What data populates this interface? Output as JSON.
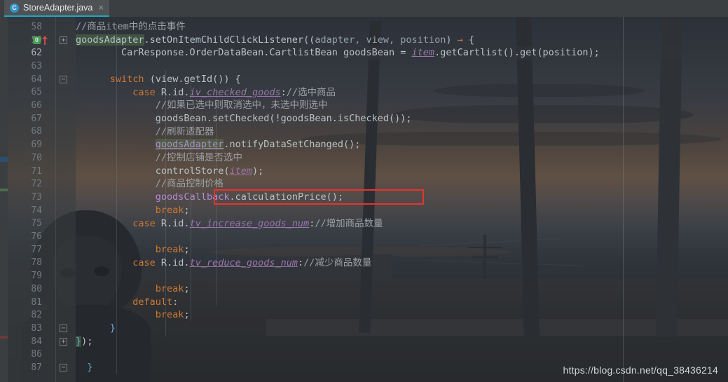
{
  "window": {
    "app": "IntelliJ IDEA code editor",
    "watermark": "https://blog.csdn.net/qq_38436214"
  },
  "tab": {
    "icon": "java-class-icon",
    "icon_letter": "C",
    "title": "StoreAdapter.java",
    "close_label": "×"
  },
  "gutter": {
    "line_numbers": [
      "58",
      "59",
      "62",
      "63",
      "64",
      "65",
      "66",
      "67",
      "68",
      "69",
      "70",
      "71",
      "72",
      "73",
      "74",
      "75",
      "76",
      "77",
      "78",
      "79",
      "80",
      "81",
      "82",
      "83",
      "84",
      "86",
      "87"
    ],
    "current_line": "62",
    "intention_bulb": "0",
    "fold_markers": [
      {
        "line": "59",
        "glyph": "+"
      },
      {
        "line": "64",
        "glyph": "−"
      },
      {
        "line": "83",
        "glyph": "−"
      },
      {
        "line": "84",
        "glyph": "+"
      },
      {
        "line": "87",
        "glyph": "−"
      }
    ]
  },
  "code": {
    "lines": [
      {
        "n": "58",
        "indent": 0,
        "tokens": [
          {
            "t": "//商品item中的点击事件",
            "c": "cmt"
          }
        ]
      },
      {
        "n": "59",
        "indent": 0,
        "tokens": [
          {
            "t": "goodsAdapter",
            "c": "plain hl"
          },
          {
            "t": ".setOnItemChildClickListener((",
            "c": "plain"
          },
          {
            "t": "adapter, view, position",
            "c": "param"
          },
          {
            "t": ") ",
            "c": "plain"
          },
          {
            "t": "→",
            "c": "arrow"
          },
          {
            "t": " {",
            "c": "plain"
          }
        ]
      },
      {
        "n": "62",
        "indent": 0,
        "tokens": [
          {
            "t": "        CarResponse.OrderDataBean.CartlistBean goodsBean = ",
            "c": "plain"
          },
          {
            "t": "item",
            "c": "fieldi"
          },
          {
            "t": ".getCartlist().get(position);",
            "c": "plain"
          }
        ]
      },
      {
        "n": "63",
        "indent": 0,
        "tokens": []
      },
      {
        "n": "64",
        "indent": 0,
        "tokens": [
          {
            "t": "      ",
            "c": "plain"
          },
          {
            "t": "switch",
            "c": "kw"
          },
          {
            "t": " (view.getId()) {",
            "c": "plain"
          }
        ]
      },
      {
        "n": "65",
        "indent": 0,
        "tokens": [
          {
            "t": "          ",
            "c": "plain"
          },
          {
            "t": "case",
            "c": "kw"
          },
          {
            "t": " R.id.",
            "c": "plain"
          },
          {
            "t": "iv_checked_goods",
            "c": "fieldi"
          },
          {
            "t": ":",
            "c": "plain"
          },
          {
            "t": "//选中商品",
            "c": "cmt"
          }
        ]
      },
      {
        "n": "66",
        "indent": 0,
        "tokens": [
          {
            "t": "              ",
            "c": "plain"
          },
          {
            "t": "//如果已选中则取消选中，未选中则选中",
            "c": "cmt"
          }
        ]
      },
      {
        "n": "67",
        "indent": 0,
        "tokens": [
          {
            "t": "              goodsBean.setChecked(!goodsBean.isChecked());",
            "c": "plain"
          }
        ]
      },
      {
        "n": "68",
        "indent": 0,
        "tokens": [
          {
            "t": "              ",
            "c": "plain"
          },
          {
            "t": "//刷新适配器",
            "c": "cmt"
          }
        ]
      },
      {
        "n": "69",
        "indent": 0,
        "tokens": [
          {
            "t": "              ",
            "c": "plain"
          },
          {
            "t": "goodsAdapter",
            "c": "field hl und"
          },
          {
            "t": ".notifyDataSetChanged();",
            "c": "plain"
          }
        ]
      },
      {
        "n": "70",
        "indent": 0,
        "tokens": [
          {
            "t": "              ",
            "c": "plain"
          },
          {
            "t": "//控制店铺是否选中",
            "c": "cmt"
          }
        ]
      },
      {
        "n": "71",
        "indent": 0,
        "tokens": [
          {
            "t": "              controlStore(",
            "c": "plain"
          },
          {
            "t": "item",
            "c": "fieldi"
          },
          {
            "t": ");",
            "c": "plain"
          }
        ]
      },
      {
        "n": "72",
        "indent": 0,
        "tokens": [
          {
            "t": "              ",
            "c": "plain"
          },
          {
            "t": "//商品控制价格",
            "c": "cmt"
          }
        ]
      },
      {
        "n": "73",
        "indent": 0,
        "tokens": [
          {
            "t": "              ",
            "c": "plain"
          },
          {
            "t": "goodsCallback",
            "c": "field"
          },
          {
            "t": ".calculationPrice();",
            "c": "plain"
          }
        ]
      },
      {
        "n": "74",
        "indent": 0,
        "tokens": [
          {
            "t": "              ",
            "c": "plain"
          },
          {
            "t": "break",
            "c": "kw"
          },
          {
            "t": ";",
            "c": "plain"
          }
        ]
      },
      {
        "n": "75",
        "indent": 0,
        "tokens": [
          {
            "t": "          ",
            "c": "plain"
          },
          {
            "t": "case",
            "c": "kw"
          },
          {
            "t": " R.id.",
            "c": "plain"
          },
          {
            "t": "tv_increase_goods_num",
            "c": "fieldi"
          },
          {
            "t": ":",
            "c": "plain"
          },
          {
            "t": "//增加商品数量",
            "c": "cmt"
          }
        ]
      },
      {
        "n": "76",
        "indent": 0,
        "tokens": []
      },
      {
        "n": "77",
        "indent": 0,
        "tokens": [
          {
            "t": "              ",
            "c": "plain"
          },
          {
            "t": "break",
            "c": "kw"
          },
          {
            "t": ";",
            "c": "plain"
          }
        ]
      },
      {
        "n": "78",
        "indent": 0,
        "tokens": [
          {
            "t": "          ",
            "c": "plain"
          },
          {
            "t": "case",
            "c": "kw"
          },
          {
            "t": " R.id.",
            "c": "plain"
          },
          {
            "t": "tv_reduce_goods_num",
            "c": "fieldi"
          },
          {
            "t": ":",
            "c": "plain"
          },
          {
            "t": "//减少商品数量",
            "c": "cmt"
          }
        ]
      },
      {
        "n": "79",
        "indent": 0,
        "tokens": []
      },
      {
        "n": "80",
        "indent": 0,
        "tokens": [
          {
            "t": "              ",
            "c": "plain"
          },
          {
            "t": "break",
            "c": "kw"
          },
          {
            "t": ";",
            "c": "plain"
          }
        ]
      },
      {
        "n": "81",
        "indent": 0,
        "tokens": [
          {
            "t": "          ",
            "c": "plain"
          },
          {
            "t": "default",
            "c": "kw"
          },
          {
            "t": ":",
            "c": "plain"
          }
        ]
      },
      {
        "n": "82",
        "indent": 0,
        "tokens": [
          {
            "t": "              ",
            "c": "plain"
          },
          {
            "t": "break",
            "c": "kw"
          },
          {
            "t": ";",
            "c": "plain"
          }
        ]
      },
      {
        "n": "83",
        "indent": 0,
        "tokens": [
          {
            "t": "      ",
            "c": "plain"
          },
          {
            "t": "}",
            "c": "brace"
          }
        ]
      },
      {
        "n": "84",
        "indent": 0,
        "tokens": [
          {
            "t": "}",
            "c": "brace hl"
          },
          {
            "t": ");",
            "c": "plain"
          }
        ]
      },
      {
        "n": "86",
        "indent": 0,
        "tokens": []
      },
      {
        "n": "87",
        "indent": 0,
        "tokens": [
          {
            "t": "  ",
            "c": "plain"
          },
          {
            "t": "}",
            "c": "brace"
          }
        ]
      }
    ]
  },
  "annotation": {
    "highlight_box_color": "#e8332f",
    "highlighted_code": "goodsCallback.calculationPrice();"
  },
  "colors": {
    "editor_bg": "#2f3136",
    "gutter_bg": "#3b3e40",
    "tab_bg": "#4e5254",
    "tab_underline": "#22a6c3",
    "keyword": "#cc7832",
    "comment": "#9ba0a3",
    "field": "#9876aa",
    "plain_text": "#b7c2c7",
    "brace": "#6aa8d8"
  }
}
